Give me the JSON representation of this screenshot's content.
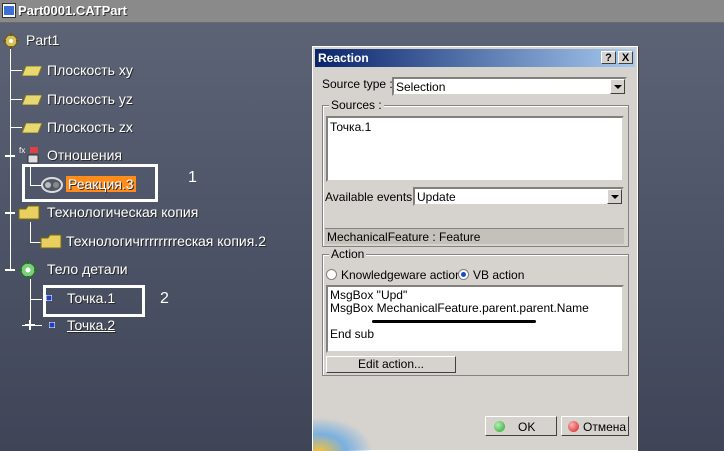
{
  "window": {
    "title": "Part0001.CATPart"
  },
  "tree": {
    "root": "Part1",
    "planes": [
      "Плоскость xy",
      "Плоскость yz",
      "Плоскость zx"
    ],
    "relations": "Отношения",
    "reaction": "Реакция.3",
    "tech_copy": "Технологическая копия",
    "tech_copy_child": "Технологичrrrrrrrrескaя копия.2",
    "body": "Тело детали",
    "point1": "Точка.1",
    "point2": "Точка.2"
  },
  "annotations": {
    "one": "1",
    "two": "2"
  },
  "dialog": {
    "title": "Reaction",
    "help_btn": "?",
    "close_btn": "X",
    "source_type_label": "Source type :",
    "source_type_value": "Selection",
    "sources_label": "Sources :",
    "sources_item": "Точка.1",
    "available_events_label": "Available events :",
    "available_events_value": "Update",
    "feature_row": "MechanicalFeature :  Feature",
    "action_label": "Action",
    "radio_knowledgeware": "Knowledgeware action",
    "radio_vb": "VB action",
    "radio_selected": "VB action",
    "code_lines": [
      "MsgBox \"Upd\"",
      "MsgBox MechanicalFeature.parent.parent.Name",
      "",
      "End sub"
    ],
    "edit_action": "Edit action...",
    "ok": "OK",
    "cancel": "Отмена"
  },
  "colors": {
    "highlight": "#ff8c1a",
    "ok_dot": "#2fa02f",
    "cancel_dot": "#d02020"
  }
}
